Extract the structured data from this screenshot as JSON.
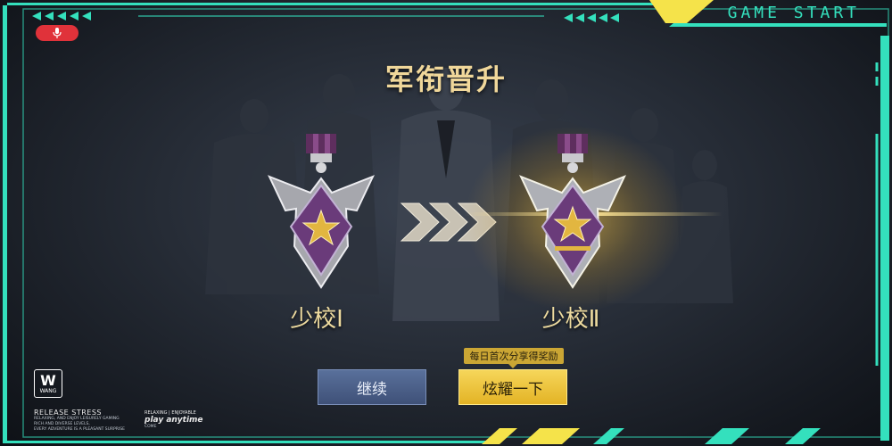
{
  "header": {
    "game_start": "GAME START"
  },
  "promotion": {
    "title": "军衔晋升"
  },
  "ranks": {
    "from": "少校Ⅰ",
    "to": "少校Ⅱ"
  },
  "buttons": {
    "continue_label": "继续",
    "show_off_label": "炫耀一下",
    "reward_tip": "每日首次分享得奖励"
  },
  "branding": {
    "logo_letter": "W",
    "logo_text": "WANG",
    "release_title": "RELEASE STRESS",
    "release_line1": "RELAXING, AND ENJOY LEISURELY GAMING",
    "release_line2": "RICH AND DIVERSE LEVELS,",
    "release_line3": "EVERY ADVENTURE IS A PLEASANT SURPRISE",
    "play_top": "RELAXING | ENJOYABLE",
    "play_main": "play anytime",
    "play_bottom": "COME"
  },
  "colors": {
    "accent": "#34e0bd",
    "gold": "#f0d79a",
    "button_yellow": "#f2cc45",
    "button_blue": "#4d638e",
    "record": "#e0323a"
  },
  "icons": {
    "record": "microphone-icon",
    "medal": "star-medal-icon",
    "arrows": "triple-chevron-icon"
  }
}
